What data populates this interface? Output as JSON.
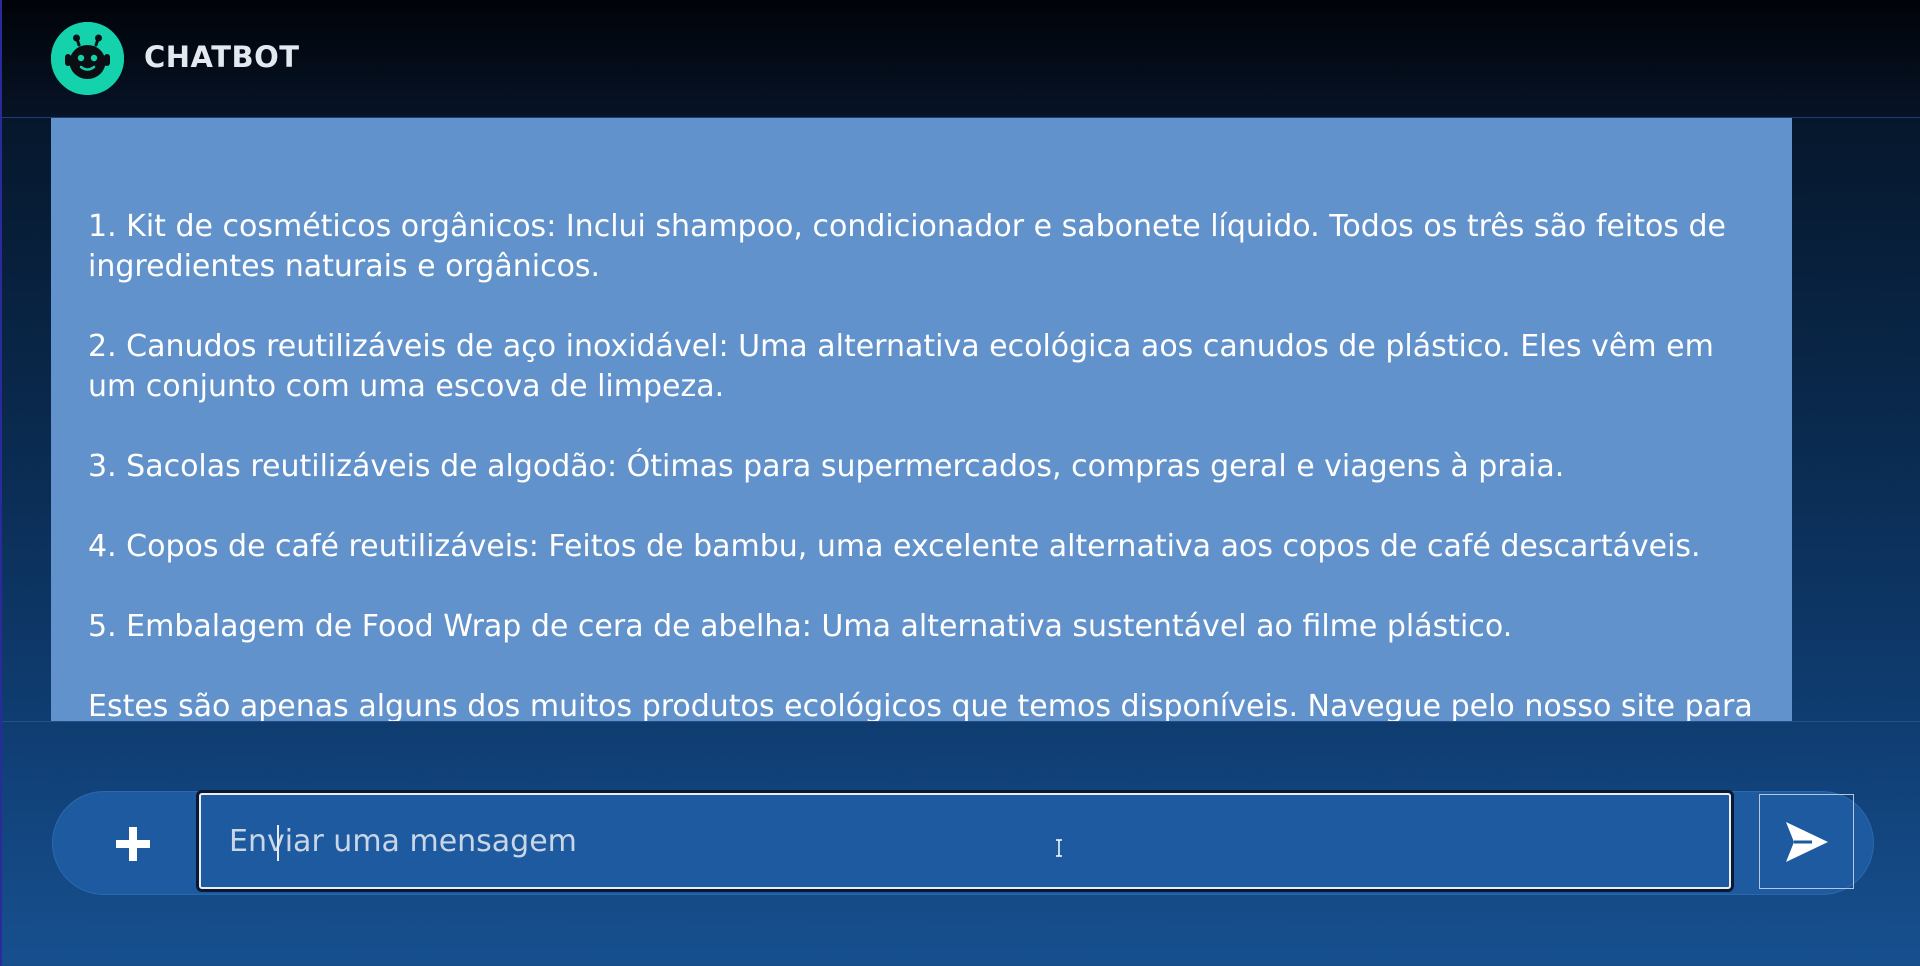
{
  "header": {
    "brand": "CHATBOT",
    "logo_icon": "robot-face-icon"
  },
  "conversation": {
    "message": {
      "paragraphs": [
        "1. Kit de cosméticos orgânicos: Inclui shampoo, condicionador e sabonete líquido. Todos os três são feitos de ingredientes naturais e orgânicos.",
        "2. Canudos reutilizáveis de aço inoxidável: Uma alternativa ecológica aos canudos de plástico. Eles vêm em um conjunto com uma escova de limpeza.",
        "3. Sacolas reutilizáveis de algodão: Ótimas para supermercados, compras geral e viagens à praia.",
        "4. Copos de café reutilizáveis: Feitos de bambu, uma excelente alternativa aos copos de café descartáveis.",
        "5. Embalagem de Food Wrap de cera de abelha: Uma alternativa sustentável ao filme plástico.",
        "Estes são apenas alguns dos muitos produtos ecológicos que temos disponíveis. Navegue pelo nosso site para descobrir mais!"
      ]
    }
  },
  "composer": {
    "placeholder": "Enviar uma mensagem",
    "value": "",
    "attach_icon": "plus-icon",
    "send_icon": "send-icon"
  },
  "colors": {
    "accent": "#14d3ac",
    "bubble": "#6192cb",
    "composer": "#1e5aa0"
  }
}
